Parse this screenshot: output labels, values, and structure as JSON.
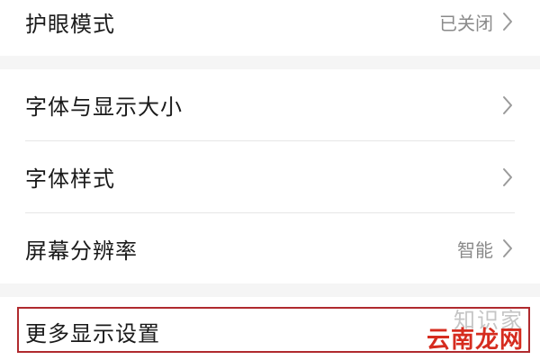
{
  "settings": {
    "eye_comfort": {
      "label": "护眼模式",
      "value": "已关闭"
    },
    "font_display_size": {
      "label": "字体与显示大小"
    },
    "font_style": {
      "label": "字体样式"
    },
    "screen_resolution": {
      "label": "屏幕分辨率",
      "value": "智能"
    },
    "more_display": {
      "label": "更多显示设置"
    }
  },
  "watermark": {
    "top": "知识家",
    "main": "云南龙网"
  },
  "colors": {
    "background": "#f5f5f5",
    "card": "#ffffff",
    "highlight": "#b02a2e",
    "watermark_red": "#d62c1f"
  },
  "icons": [
    "chevron-right-icon"
  ]
}
